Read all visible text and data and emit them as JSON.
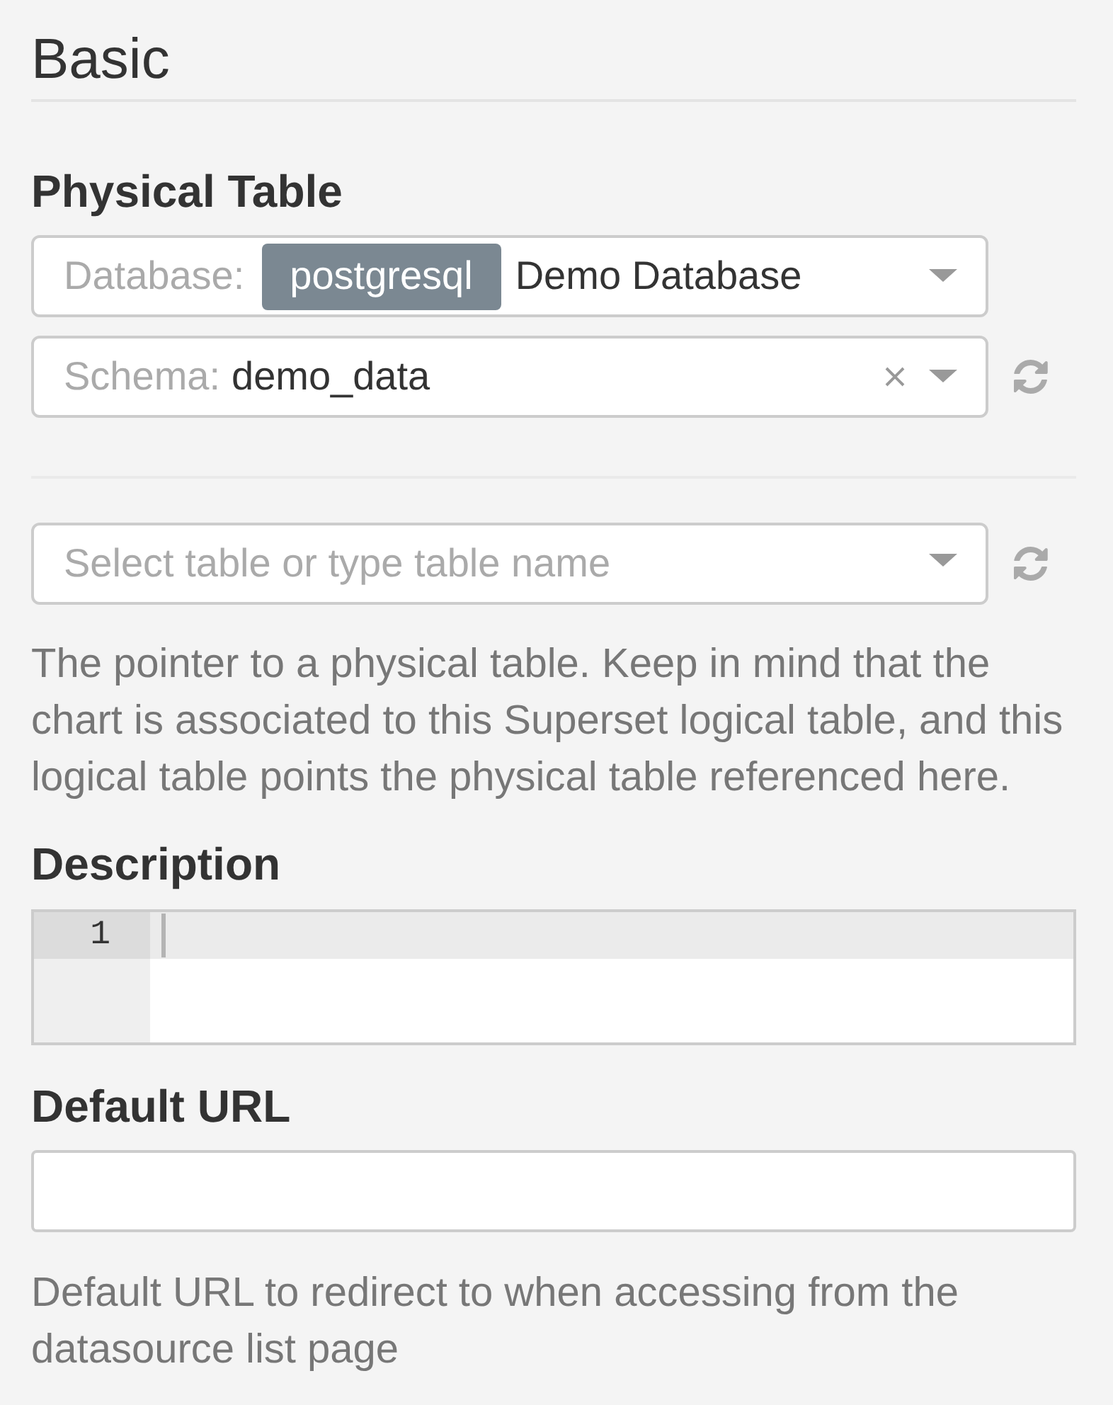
{
  "section": {
    "title": "Basic"
  },
  "physical_table": {
    "label": "Physical Table",
    "database_select": {
      "label": "Database:",
      "tag": "postgresql",
      "value": "Demo Database"
    },
    "schema_select": {
      "label": "Schema:",
      "value": "demo_data",
      "clearable": true,
      "refreshable": true
    },
    "table_select": {
      "placeholder": "Select table or type table name",
      "refreshable": true
    },
    "help": "The pointer to a physical table. Keep in mind that the chart is associated to this Superset logical table, and this logical table points the physical table referenced here."
  },
  "description": {
    "label": "Description",
    "editor": {
      "focused": true,
      "line_numbers": [
        "1"
      ]
    }
  },
  "default_url": {
    "label": "Default URL",
    "help": "Default URL to redirect to when accessing from the datasource list page"
  }
}
